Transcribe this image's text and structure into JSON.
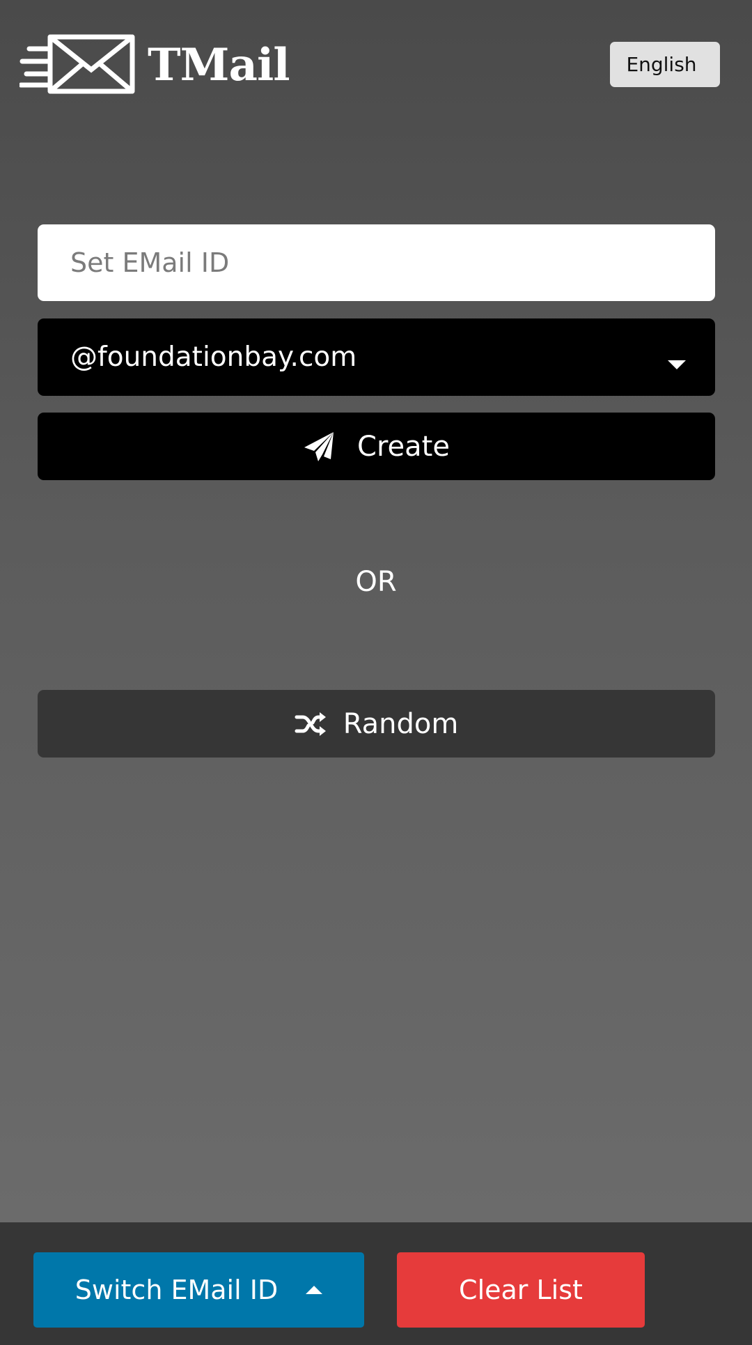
{
  "header": {
    "logo_text": "TMail",
    "language_button": "English"
  },
  "form": {
    "email_placeholder": "Set EMail ID",
    "email_value": "",
    "domain_selected": "@foundationbay.com",
    "create_label": "Create",
    "or_label": "OR",
    "random_label": "Random"
  },
  "footer": {
    "switch_label": "Switch EMail ID",
    "clear_label": "Clear List"
  },
  "colors": {
    "switch_button": "#0077aa",
    "clear_button": "#e63b3b",
    "random_button": "#363636",
    "create_button": "#000000"
  },
  "icons": {
    "logo": "envelope-icon",
    "create": "paper-plane-icon",
    "random": "shuffle-icon",
    "domain_dropdown": "caret-down-icon",
    "switch": "caret-up-icon"
  }
}
